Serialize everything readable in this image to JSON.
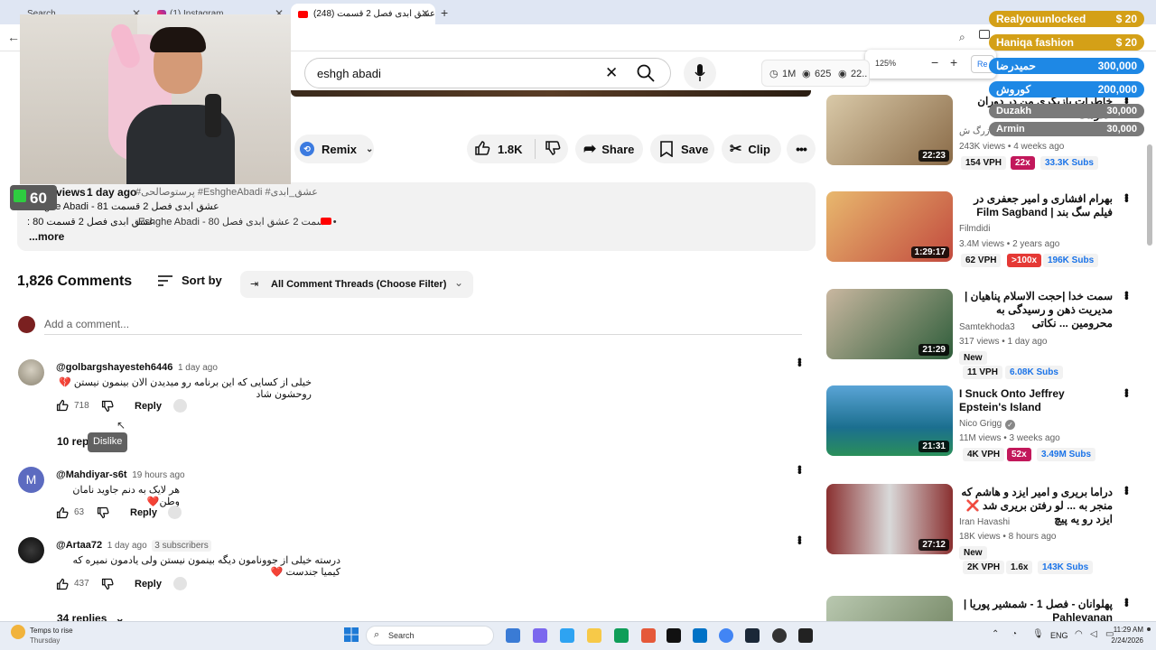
{
  "browser": {
    "tabs": [
      {
        "label": "Search"
      },
      {
        "label": "(1) Instagram"
      },
      {
        "label": "(248) عشق ابدی فصل 2 قسمت"
      }
    ],
    "new_tab": "+",
    "zoom_popup": {
      "value": "125%",
      "minus": "−",
      "plus": "+",
      "reset": "Re"
    }
  },
  "webcam": {
    "badge": "60"
  },
  "youtube": {
    "search_value": "eshgh abadi",
    "stats": {
      "views": "1M",
      "eyes": "625",
      "live": "22.."
    },
    "actions": {
      "remix": "Remix",
      "likes": "1.8K",
      "share": "Share",
      "save": "Save",
      "clip": "Clip"
    },
    "description": {
      "views": "167K views",
      "time": "1 day ago",
      "tags": "#پرستوصالحی #EshgheAbadi #عشق_ابدی",
      "line1": "Eshghe Abadi - 81 عشق ابدی فصل 2 قسمت",
      "line2a": ": 80 عشق ابدی فصل 2 قسمت",
      "line2b": "Eshghe Abadi - 80 قسمت 2 عشق ابدی فصل •",
      "more": "...more"
    },
    "comments_header": {
      "count": "1,826 Comments",
      "sort": "Sort by",
      "filter": "All Comment Threads (Choose Filter)"
    },
    "add_comment": "Add a comment...",
    "comments": [
      {
        "handle": "@golbargshayesteh6446",
        "time": "1 day ago",
        "text": "خیلی از کسایی که این برنامه رو میدیدن الان بینمون نیستن 💔 روحشون شاد",
        "likes": "718",
        "reply": "Reply",
        "replies": "10 rep"
      },
      {
        "handle": "@Mahdiyar-s6t",
        "time": "19 hours ago",
        "text": "هر لایک به دنم جاوید نامان وطن❤️",
        "likes": "63",
        "reply": "Reply"
      },
      {
        "handle": "@Artaa72",
        "time": "1 day ago",
        "subs": "3 subscribers",
        "text": "درسته خیلی از جوونامون دیگه بینمون نیستن ولی یادمون نمیره که کیمیا جندست ❤️",
        "likes": "437",
        "reply": "Reply",
        "replies": "34 replies"
      }
    ],
    "tooltip": "Dislike",
    "avatar_letter": "M"
  },
  "sidebar_videos": [
    {
      "title": "خاطرات بازیگری من در دوران حکومت ...Human",
      "channel": "زرگ ش",
      "meta": "243K views • 4 weeks ago",
      "duration": "22:23",
      "vph": "154 VPH",
      "mult": "22x",
      "subs": "33.3K Subs"
    },
    {
      "title": "بهرام افشاری و امیر جعفری در فیلم سگ بند | Film Sagband",
      "channel": "Filmdidi",
      "meta": "3.4M views • 2 years ago",
      "duration": "1:29:17",
      "vph": "62 VPH",
      "mult": ">100x",
      "subs": "196K Subs"
    },
    {
      "title": "سمت خدا |حجت الاسلام پناهیان | مدیریت ذهن و رسیدگی به محرومین ... نکاتی",
      "channel": "Samtekhoda3",
      "meta": "317 views • 1 day ago",
      "badge": "New",
      "duration": "21:29",
      "vph": "11 VPH",
      "subs": "6.08K Subs"
    },
    {
      "title": "I Snuck Onto Jeffrey Epstein's Island",
      "channel": "Nico Grigg",
      "meta": "11M views • 3 weeks ago",
      "duration": "21:31",
      "vph": "4K VPH",
      "mult": "52x",
      "subs": "3.49M Subs"
    },
    {
      "title": "دراما بریری و امیر ایزد و هاشم که منجر به ... لو رفتن بریری شد ❌ ایزد رو یه پیچ",
      "channel": "Iran Havashi",
      "meta": "18K views • 8 hours ago",
      "badge": "New",
      "duration": "27:12",
      "vph": "2K VPH",
      "mult": "1.6x",
      "subs": "143K Subs"
    },
    {
      "title": "پهلوانان - فصل 1 - شمشیر پوریا | Pahlevanan",
      "channel": "",
      "meta": "",
      "duration": ""
    }
  ],
  "donations": [
    {
      "name": "Realyouunlocked",
      "amount": "$ 20"
    },
    {
      "name": "Haniqa fashion",
      "amount": "$ 20"
    },
    {
      "name": "حمیدرضا",
      "amount": "300,000"
    },
    {
      "name": "کوروش",
      "amount": "200,000"
    },
    {
      "name": "Duzakh",
      "amount": "30,000"
    },
    {
      "name": "Armin",
      "amount": "30,000"
    }
  ],
  "taskbar": {
    "weather_title": "Temps to rise",
    "weather_sub": "Thursday",
    "search": "Search",
    "lang": "ENG",
    "time": "11:29 AM",
    "date": "2/24/2026"
  }
}
